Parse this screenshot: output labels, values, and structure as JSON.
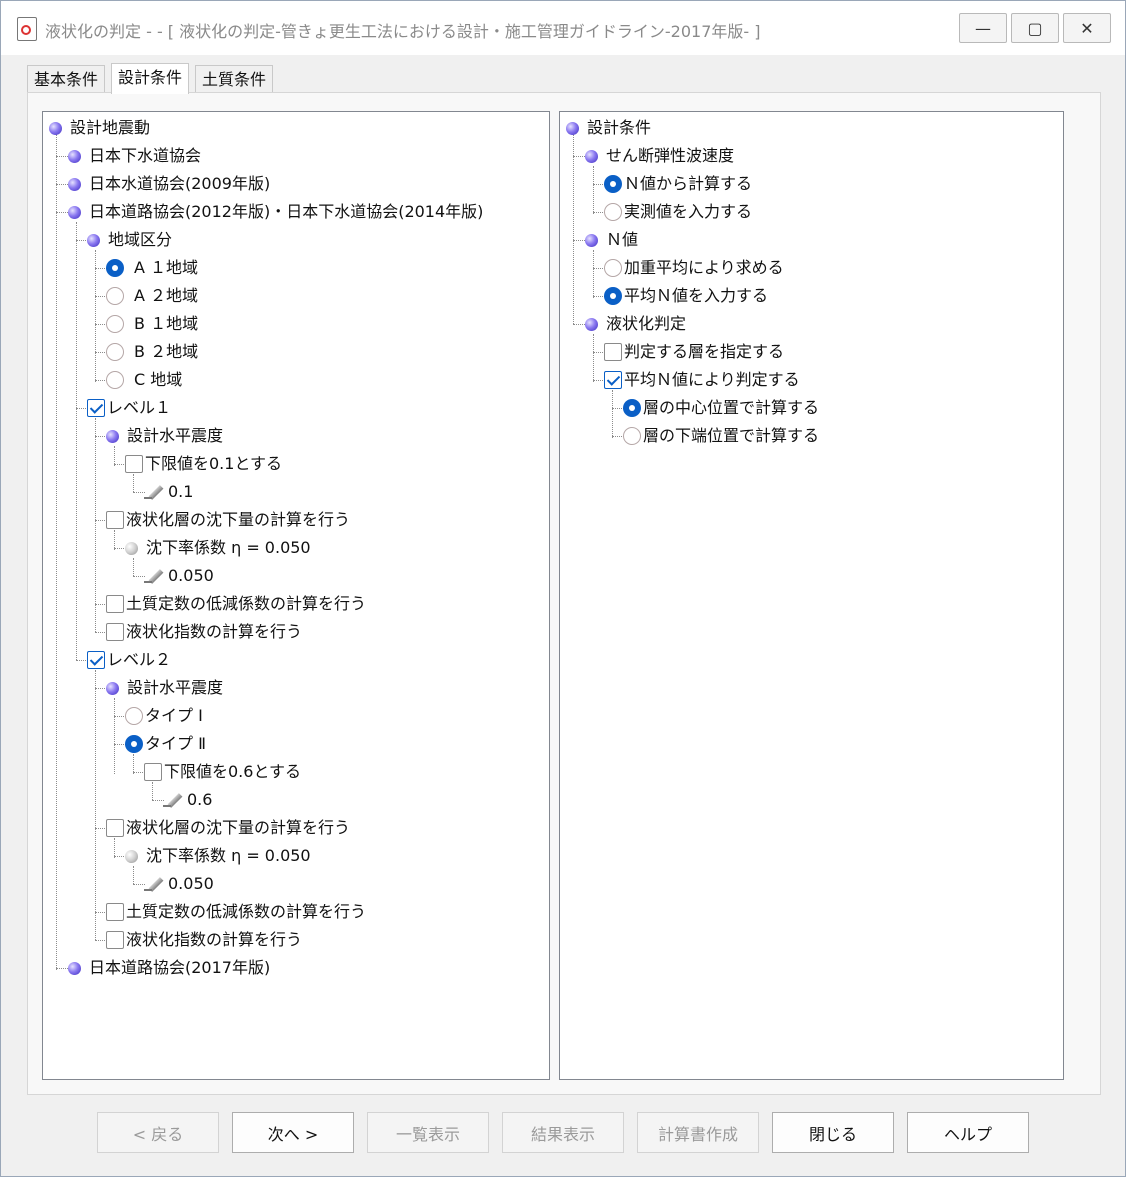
{
  "window": {
    "title": "液状化の判定 -  - [ 液状化の判定-管きょ更生工法における設計・施工管理ガイドライン-2017年版- ]",
    "minimize_icon": "minimize-icon",
    "maximize_icon": "maximize-icon",
    "close_icon": "close-icon"
  },
  "tabs": [
    "基本条件",
    "設計条件",
    "土質条件"
  ],
  "active_tab": "設計条件",
  "left_tree": {
    "root": "設計地震動",
    "std_jswa": "日本下水道協会",
    "std_jwwa2009": "日本水道協会(2009年版)",
    "std_jra2012": "日本道路協会(2012年版)・日本下水道協会(2014年版)",
    "region_group": "地域区分",
    "regions": [
      "A １地域",
      "A ２地域",
      "B １地域",
      "B ２地域",
      "C 地域"
    ],
    "region_selected_index": 0,
    "level1": {
      "label": "レベル１",
      "checked": true,
      "khc": "設計水平震度",
      "lower_limit": "下限値を0.1とする",
      "lower_limit_checked": false,
      "lower_limit_value": "0.1",
      "settlement": "液状化層の沈下量の計算を行う",
      "settlement_checked": false,
      "ratio": "沈下率係数 η = 0.050",
      "ratio_value": "0.050",
      "reduction": "土質定数の低減係数の計算を行う",
      "reduction_checked": false,
      "index": "液状化指数の計算を行う",
      "index_checked": false
    },
    "level2": {
      "label": "レベル２",
      "checked": true,
      "khc": "設計水平震度",
      "type1": "タイプ Ⅰ",
      "type2": "タイプ Ⅱ",
      "type_selected": "タイプ Ⅱ",
      "lower_limit": "下限値を0.6とする",
      "lower_limit_checked": false,
      "lower_limit_value": "0.6",
      "settlement": "液状化層の沈下量の計算を行う",
      "settlement_checked": false,
      "ratio": "沈下率係数 η = 0.050",
      "ratio_value": "0.050",
      "reduction": "土質定数の低減係数の計算を行う",
      "reduction_checked": false,
      "index": "液状化指数の計算を行う",
      "index_checked": false
    },
    "std_jra2017": "日本道路協会(2017年版)"
  },
  "right_tree": {
    "root": "設計条件",
    "vs_group": "せん断弾性波速度",
    "vs_opt1": "Ｎ値から計算する",
    "vs_opt2": "実測値を入力する",
    "vs_selected": "Ｎ値から計算する",
    "n_group": "Ｎ値",
    "n_opt1": "加重平均により求める",
    "n_opt2": "平均Ｎ値を入力する",
    "n_selected": "平均Ｎ値を入力する",
    "judge_group": "液状化判定",
    "judge_layer": "判定する層を指定する",
    "judge_layer_checked": false,
    "judge_avg": "平均Ｎ値により判定する",
    "judge_avg_checked": true,
    "pos_center": "層の中心位置で計算する",
    "pos_bottom": "層の下端位置で計算する",
    "pos_selected": "層の中心位置で計算する"
  },
  "buttons": {
    "back": "< 戻る",
    "next": "次へ >",
    "list": "一覧表示",
    "result": "結果表示",
    "report": "計算書作成",
    "close": "閉じる",
    "help": "ヘルプ"
  }
}
